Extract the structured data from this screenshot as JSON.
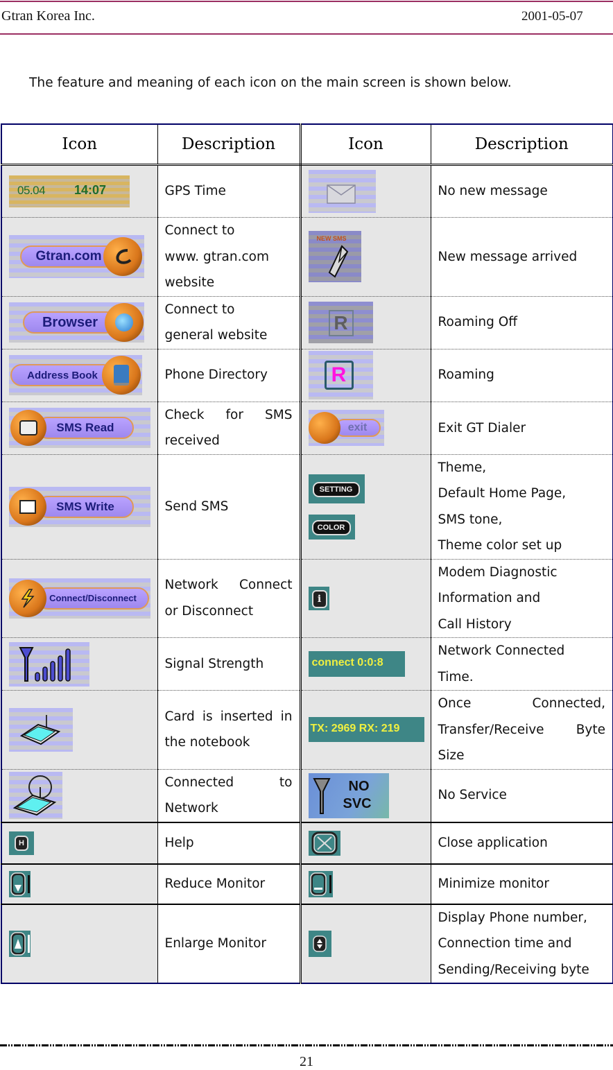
{
  "header": {
    "company": "Gtran Korea Inc.",
    "date": "2001-05-07",
    "rule_color": "#9b2f62"
  },
  "intro": "The feature and meaning of each icon on the main screen is shown below.",
  "table": {
    "headers": [
      "Icon",
      "Description",
      "Icon",
      "Description"
    ],
    "border_color": "#000066",
    "rows": [
      {
        "left": {
          "icon": "gps-time-display-icon",
          "icon_text": [
            "05.04",
            "14:07"
          ],
          "description": "GPS Time"
        },
        "right": {
          "icon": "envelope-icon",
          "description": "No new message"
        }
      },
      {
        "left": {
          "icon": "gtran-com-button-icon",
          "icon_text": [
            "Gtran.com"
          ],
          "description": "Connect to\nwww. gtran.com\nwebsite"
        },
        "right": {
          "icon": "new-sms-envelope-icon",
          "icon_text": [
            "NEW SMS"
          ],
          "description": "New message arrived"
        }
      },
      {
        "left": {
          "icon": "browser-button-icon",
          "icon_text": [
            "Browser"
          ],
          "description": "Connect to\ngeneral website"
        },
        "right": {
          "icon": "roaming-off-icon",
          "icon_text": [
            "R"
          ],
          "description": "Roaming Off"
        }
      },
      {
        "left": {
          "icon": "address-book-button-icon",
          "icon_text": [
            "Address Book"
          ],
          "description": "Phone Directory"
        },
        "right": {
          "icon": "roaming-icon",
          "icon_text": [
            "R"
          ],
          "description": "Roaming"
        }
      },
      {
        "left": {
          "icon": "sms-read-button-icon",
          "icon_text": [
            "SMS Read"
          ],
          "description": "Check for SMS received"
        },
        "right": {
          "icon": "exit-button-icon",
          "icon_text": [
            "exit"
          ],
          "description": "Exit GT Dialer"
        }
      },
      {
        "left": {
          "icon": "sms-write-button-icon",
          "icon_text": [
            "SMS Write"
          ],
          "description": "Send SMS"
        },
        "right": {
          "icon": "setting-color-buttons-icon",
          "icon_text": [
            "SETTING",
            "COLOR"
          ],
          "description": "Theme,\nDefault Home Page,\nSMS tone,\nTheme color set up"
        }
      },
      {
        "left": {
          "icon": "connect-disconnect-button-icon",
          "icon_text": [
            "Connect/Disconnect"
          ],
          "description": "Network Connect or Disconnect"
        },
        "right": {
          "icon": "info-icon",
          "icon_text": [
            "i"
          ],
          "description": "Modem Diagnostic\nInformation and\nCall History"
        }
      },
      {
        "left": {
          "icon": "signal-strength-icon",
          "description": "Signal Strength"
        },
        "right": {
          "icon": "connect-time-display-icon",
          "icon_text": [
            "connect 0:0:8"
          ],
          "description": "Network Connected\nTime."
        }
      },
      {
        "left": {
          "icon": "card-inserted-icon",
          "description": "Card is inserted in the notebook"
        },
        "right": {
          "icon": "tx-rx-display-icon",
          "icon_text": [
            "TX: 2969 RX: 219"
          ],
          "description": "Once Connected, Transfer/Receive Byte Size"
        }
      },
      {
        "left": {
          "icon": "connected-network-icon",
          "description": "Connected to Network"
        },
        "right": {
          "icon": "no-service-icon",
          "icon_text": [
            "NO",
            "SVC"
          ],
          "description": "No Service"
        }
      },
      {
        "left": {
          "icon": "help-icon",
          "icon_text": [
            "H"
          ],
          "description": "Help"
        },
        "right": {
          "icon": "close-icon",
          "description": "Close application"
        }
      },
      {
        "left": {
          "icon": "reduce-monitor-icon",
          "description": "Reduce Monitor"
        },
        "right": {
          "icon": "minimize-monitor-icon",
          "description": "Minimize monitor"
        }
      },
      {
        "left": {
          "icon": "enlarge-monitor-icon",
          "description": "Enlarge Monitor"
        },
        "right": {
          "icon": "display-toggle-icon",
          "description": "Display Phone number,\nConnection time and\nSending/Receiving byte"
        }
      }
    ]
  },
  "footer": {
    "page_number": "21"
  }
}
